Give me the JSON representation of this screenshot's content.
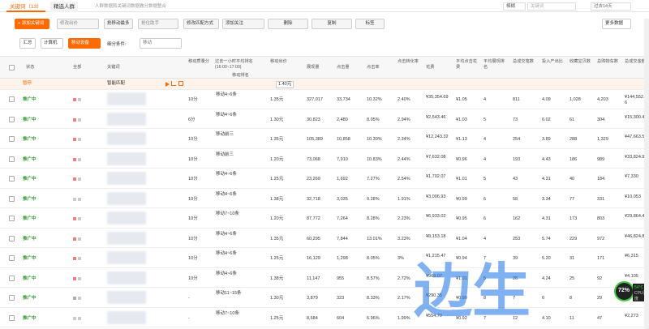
{
  "tabs": {
    "keywords": "关键词（13）",
    "crowd": "精选人群",
    "tips": "人群数据和关键词数据做分数据整合"
  },
  "top_right": {
    "select": "模糊",
    "search_placeholder": "关键词",
    "range": "过去14天"
  },
  "toolbar": {
    "add_keyword": "+ 添加关键词",
    "modify_bid": "修改出价",
    "shift_bid": "抢移动最多",
    "price_assist": "抢位助手",
    "modify_match": "修改匹配方式",
    "add_follow": "添加关注",
    "delete": "删除",
    "copy": "复制",
    "tag": "标签",
    "more_data": "更多数据"
  },
  "subbar": {
    "summary": "汇总",
    "computer": "计算机",
    "mobile": "移动设备",
    "filter": "细分条件:",
    "filter_value": "移动"
  },
  "headers": [
    "状态",
    "全部",
    "关键词",
    "移动质量分",
    "过去一小时平均排名(16:00~17:00)",
    "移动出价",
    "展现量",
    "点击量",
    "点击率",
    "点击转化率",
    "花费",
    "平均点击花费",
    "平均展现排名",
    "总成交笔数",
    "投入产出比",
    "收藏宝贝数",
    "总购物车数",
    "总成交金额"
  ],
  "header_sub": "移动排名",
  "smart": {
    "status": "暂停",
    "keyword": "智能匹配",
    "bid": "1.40元"
  },
  "rows": [
    {
      "status": "推广中",
      "score": "10分",
      "rank": "移动4~6条",
      "bid": "1.35元",
      "imp": "327,017",
      "clicks": "33,734",
      "ctr": "10.32%",
      "cvr": "2.40%",
      "cost": "¥35,354.69",
      "cpc": "¥1.05",
      "pos": "4",
      "deals": "811",
      "roi": "4.09",
      "fav": "1,028",
      "cart": "4,203",
      "amount": "¥144,552.16"
    },
    {
      "status": "推广中",
      "score": "6分",
      "rank": "移动4~6条",
      "bid": "1.30元",
      "imp": "30,823",
      "clicks": "2,480",
      "ctr": "8.05%",
      "cvr": "2.94%",
      "cost": "¥2,543.46",
      "cpc": "¥1.03",
      "pos": "5",
      "deals": "73",
      "roi": "6.02",
      "fav": "61",
      "cart": "304",
      "amount": "¥15,300.46"
    },
    {
      "status": "推广中",
      "score": "10分",
      "rank": "移动前三",
      "bid": "1.35元",
      "imp": "105,389",
      "clicks": "10,858",
      "ctr": "10.30%",
      "cvr": "2.34%",
      "cost": "¥12,243.32",
      "cpc": "¥1.13",
      "pos": "4",
      "deals": "254",
      "roi": "3.89",
      "fav": "288",
      "cart": "1,329",
      "amount": "¥47,663.56"
    },
    {
      "status": "推广中",
      "score": "10分",
      "rank": "移动前三",
      "bid": "1.20元",
      "imp": "73,068",
      "clicks": "7,910",
      "ctr": "10.83%",
      "cvr": "2.44%",
      "cost": "¥7,632.08",
      "cpc": "¥0.96",
      "pos": "4",
      "deals": "193",
      "roi": "4.43",
      "fav": "186",
      "cart": "989",
      "amount": "¥33,824.98"
    },
    {
      "status": "推广中",
      "score": "10分",
      "rank": "移动4~6条",
      "bid": "1.25元",
      "imp": "23,269",
      "clicks": "1,692",
      "ctr": "7.27%",
      "cvr": "2.54%",
      "cost": "¥1,702.07",
      "cpc": "¥1.01",
      "pos": "5",
      "deals": "43",
      "roi": "4.31",
      "fav": "40",
      "cart": "184",
      "amount": "¥7,330"
    },
    {
      "status": "推广中",
      "score": "10分",
      "rank": "移动4~6条",
      "bid": "1.38元",
      "imp": "32,718",
      "clicks": "3,035",
      "ctr": "9.28%",
      "cvr": "1.91%",
      "cost": "¥3,006.93",
      "cpc": "¥0.99",
      "pos": "6",
      "deals": "58",
      "roi": "3.34",
      "fav": "77",
      "cart": "331",
      "amount": "¥10,053"
    },
    {
      "status": "推广中",
      "score": "10分",
      "rank": "移动7~10条",
      "bid": "1.20元",
      "imp": "87,772",
      "clicks": "7,264",
      "ctr": "8.28%",
      "cvr": "2.23%",
      "cost": "¥6,933.02",
      "cpc": "¥0.95",
      "pos": "6",
      "deals": "162",
      "roi": "4.31",
      "fav": "173",
      "cart": "803",
      "amount": "¥29,864.40"
    },
    {
      "status": "推广中",
      "score": "10分",
      "rank": "移动4~6条",
      "bid": "1.35元",
      "imp": "60,295",
      "clicks": "7,844",
      "ctr": "13.01%",
      "cvr": "3.23%",
      "cost": "¥8,153.18",
      "cpc": "¥1.04",
      "pos": "4",
      "deals": "253",
      "roi": "5.74",
      "fav": "229",
      "cart": "972",
      "amount": "¥46,824.81"
    },
    {
      "status": "推广中",
      "score": "10分",
      "rank": "移动4~6条",
      "bid": "1.25元",
      "imp": "16,129",
      "clicks": "1,298",
      "ctr": "8.05%",
      "cvr": "3%",
      "cost": "¥1,215.47",
      "cpc": "¥0.94",
      "pos": "7",
      "deals": "39",
      "roi": "5.20",
      "fav": "31",
      "cart": "171",
      "amount": "¥6,315"
    },
    {
      "status": "推广中",
      "score": "10分",
      "rank": "移动4~6条",
      "bid": "1.38元",
      "imp": "11,147",
      "clicks": "955",
      "ctr": "8.57%",
      "cvr": "2.72%",
      "cost": "¥969.07",
      "cpc": "¥1.01",
      "pos": "5",
      "deals": "26",
      "roi": "4.24",
      "fav": "25",
      "cart": "92",
      "amount": "¥4,105"
    },
    {
      "status": "推广中",
      "score": "-",
      "rank": "移动11~15条",
      "bid": "1.30元",
      "imp": "3,879",
      "clicks": "323",
      "ctr": "8.33%",
      "cvr": "2.17%",
      "cost": "¥290.35",
      "cpc": "¥0.90",
      "pos": "8",
      "deals": "7",
      "roi": "6",
      "fav": "8",
      "cart": "29",
      "amount": "¥1,742"
    },
    {
      "status": "推广中",
      "score": "-",
      "rank": "移动7~10条",
      "bid": "1.25元",
      "imp": "8,684",
      "clicks": "604",
      "ctr": "6.96%",
      "cvr": "1.99%",
      "cost": "¥554.70",
      "cpc": "¥0.92",
      "pos": "7",
      "deals": "12",
      "roi": "4.10",
      "fav": "11",
      "cart": "47",
      "amount": "¥2,273"
    }
  ],
  "watermark": "边生",
  "widget": {
    "pct": "72%",
    "temp": "54°C",
    "cpu": "CPU温度"
  },
  "colors": {
    "accent": "#ff6a00",
    "status": "#2f9e2f"
  }
}
